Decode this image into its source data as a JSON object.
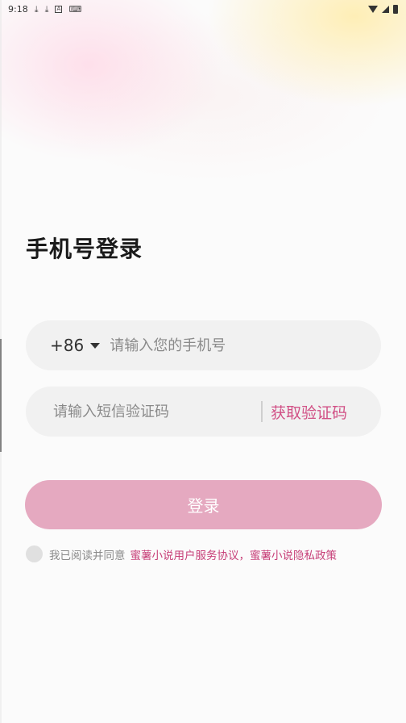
{
  "status_bar": {
    "time": "9:18",
    "left_icons": [
      "download-icon",
      "download-icon",
      "a-box-icon",
      "keyboard-icon"
    ],
    "right_icons": [
      "wifi-icon",
      "signal-icon",
      "battery-icon"
    ]
  },
  "login": {
    "title": "手机号登录",
    "country_code": "+86",
    "phone_placeholder": "请输入您的手机号",
    "code_placeholder": "请输入短信验证码",
    "get_code_label": "获取验证码",
    "submit_label": "登录"
  },
  "agreement": {
    "prefix": "我已阅读并同意",
    "terms_link": "蜜薯小说用户服务协议",
    "separator": "，",
    "privacy_link": "蜜薯小说隐私政策"
  },
  "colors": {
    "accent": "#d14f85",
    "button_bg": "#e5a9c0",
    "field_bg": "#f1f1f1"
  }
}
